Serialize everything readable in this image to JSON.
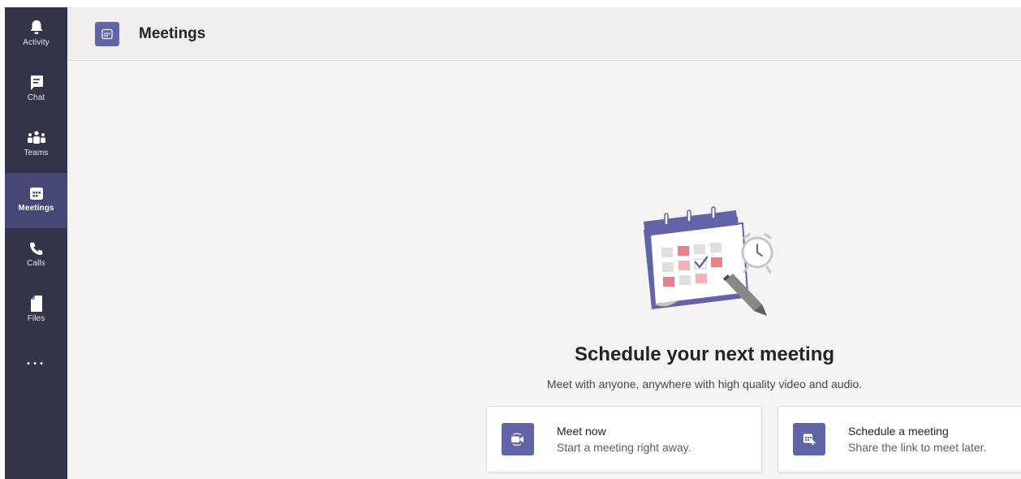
{
  "rail": {
    "items": [
      {
        "label": "Activity",
        "icon": "bell-icon"
      },
      {
        "label": "Chat",
        "icon": "chat-icon"
      },
      {
        "label": "Teams",
        "icon": "teams-icon"
      },
      {
        "label": "Meetings",
        "icon": "calendar-icon",
        "active": true
      },
      {
        "label": "Calls",
        "icon": "phone-icon"
      },
      {
        "label": "Files",
        "icon": "file-icon"
      }
    ],
    "more_label": "..."
  },
  "header": {
    "title": "Meetings",
    "icon": "calendar-icon"
  },
  "hero": {
    "title": "Schedule your next meeting",
    "subtitle": "Meet with anyone, anywhere with high quality video and audio."
  },
  "cards": [
    {
      "title": "Meet now",
      "subtitle": "Start a meeting right away.",
      "icon": "video-camera-icon"
    },
    {
      "title": "Schedule a meeting",
      "subtitle": "Share the link to meet later.",
      "icon": "calendar-add-icon"
    }
  ],
  "colors": {
    "rail_bg": "#33344a",
    "rail_active": "#464775",
    "accent": "#6264a7",
    "content_bg": "#f5f4f3"
  }
}
